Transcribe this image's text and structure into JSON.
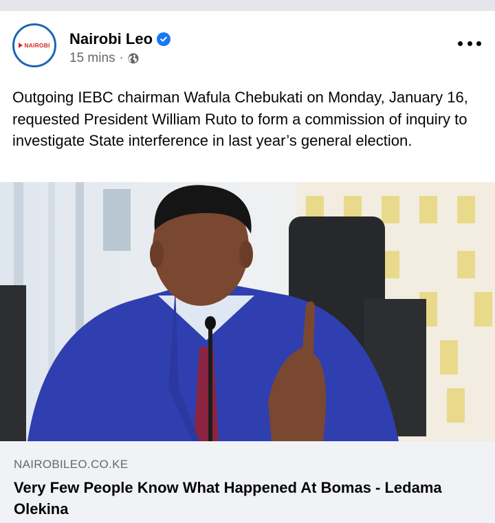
{
  "page": {
    "name": "Nairobi Leo",
    "avatar_text": "NAIROBI",
    "timestamp": "15 mins",
    "separator": "·",
    "verified_icon": "verified-check-icon",
    "privacy_icon": "globe-icon"
  },
  "post": {
    "text": "Outgoing IEBC chairman Wafula Chebukati on Monday, January 16, requested President William Ruto to form a commission of inquiry to investigate State interference in last year’s general election."
  },
  "link": {
    "domain": "NAIROBILEO.CO.KE",
    "title": "Very Few People Know What Happened At Bomas - Ledama Olekina"
  },
  "colors": {
    "verified": "#1877f2",
    "avatar_ring": "#1e64b4",
    "logo_red": "#d62828",
    "meta_gray": "#65676b",
    "card_bg": "#f0f2f5"
  }
}
